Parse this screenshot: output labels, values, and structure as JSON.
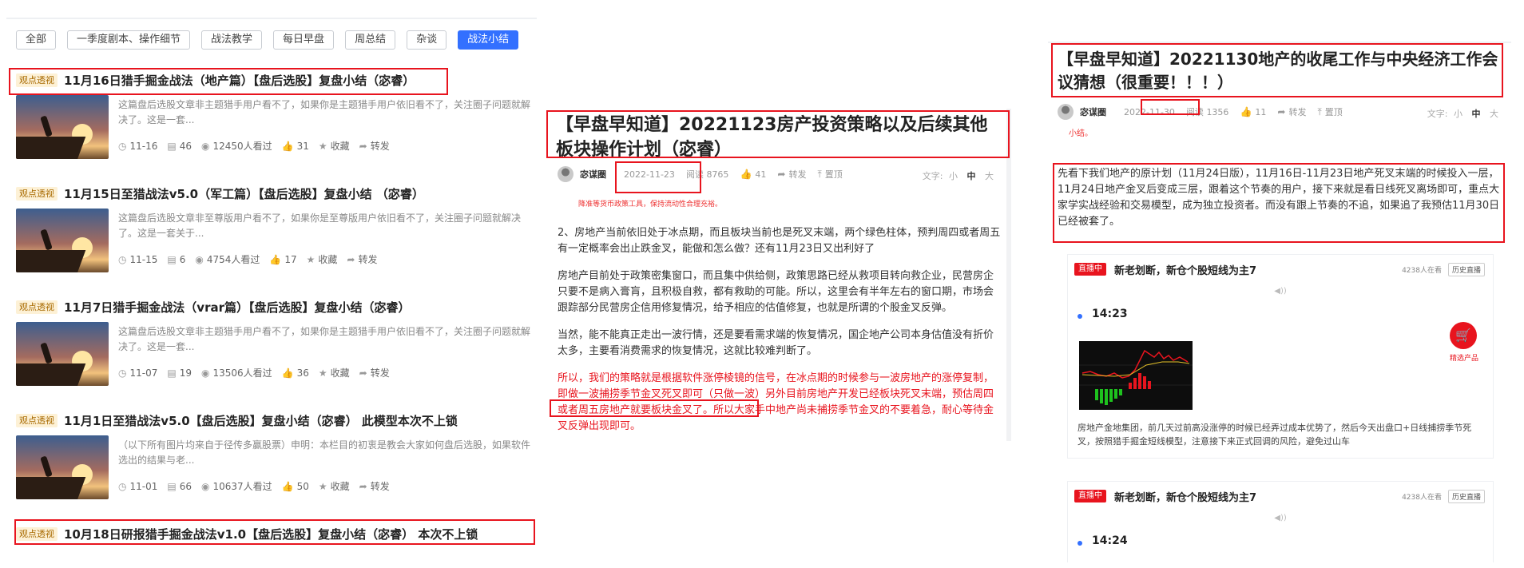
{
  "panel1": {
    "tabs": [
      "全部",
      "一季度剧本、操作细节",
      "战法教学",
      "每日早盘",
      "周总结",
      "杂谈",
      "战法小结"
    ],
    "active_tab": "战法小结",
    "articles": [
      {
        "badge": "观点透视",
        "title": "11月16日猎手掘金战法（地产篇）【盘后选股】复盘小结（宓睿）",
        "desc": "这篇盘后选股文章非主题猎手用户看不了，如果你是主题猎手用户依旧看不了，关注圈子问题就解决了。这是一套...",
        "date": "11-16",
        "comments": "46",
        "views": "12450人看过",
        "likes": "31",
        "fav": "收藏",
        "share": "转发"
      },
      {
        "badge": "观点透视",
        "title": "11月15日至猎战法v5.0（军工篇）【盘后选股】复盘小结 （宓睿）",
        "desc": "这篇盘后选股文章非至尊版用户看不了，如果你是至尊版用户依旧看不了，关注圈子问题就解决了。这是一套关于...",
        "date": "11-15",
        "comments": "6",
        "views": "4754人看过",
        "likes": "17",
        "fav": "收藏",
        "share": "转发"
      },
      {
        "badge": "观点透视",
        "title": "11月7日猎手掘金战法（vrar篇）【盘后选股】复盘小结（宓睿）",
        "desc": "这篇盘后选股文章非主题猎手用户看不了，如果你是主题猎手用户依旧看不了，关注圈子问题就解决了。这是一套...",
        "date": "11-07",
        "comments": "19",
        "views": "13506人看过",
        "likes": "36",
        "fav": "收藏",
        "share": "转发"
      },
      {
        "badge": "观点透视",
        "title": "11月1日至猎战法v5.0【盘后选股】复盘小结（宓睿） 此模型本次不上锁",
        "desc": "（以下所有图片均来自于径传多赢股票）申明：本栏目的初衷是教会大家如何盘后选股，如果软件选出的结果与老...",
        "date": "11-01",
        "comments": "66",
        "views": "10637人看过",
        "likes": "50",
        "fav": "收藏",
        "share": "转发"
      },
      {
        "badge": "观点透视",
        "title": "10月18日研报猎手掘金战法v1.0【盘后选股】复盘小结（宓睿） 本次不上锁"
      }
    ]
  },
  "panel2": {
    "title": "【早盘早知道】20221123房产投资策略以及后续其他板块操作计划（宓睿）",
    "author": "宓谋圈",
    "date": "2022-11-23",
    "read_label": "阅读",
    "read_count": "8765",
    "likes": "41",
    "share": "转发",
    "pin": "置顶",
    "font_label": "文字:",
    "font_options": [
      "小",
      "中",
      "大"
    ],
    "tip": "降准等货币政策工具，保持流动性合理充裕。",
    "paragraphs": [
      "2、房地产当前依旧处于冰点期，而且板块当前也是死叉末端，两个绿色柱体，预判周四或者周五有一定概率会出止跌金叉，能做和怎么做？还有11月23日又出利好了",
      "房地产目前处于政策密集窗口，而且集中供给侧，政策思路已经从救项目转向救企业，民营房企只要不是病入膏肓，且积极自救，都有救助的可能。所以，这里会有半年左右的窗口期，市场会跟踪部分民营房企信用修复情况，给予相应的估值修复，也就是所谓的个股金叉反弹。",
      "当然，能不能真正走出一波行情，还是要看需求端的恢复情况，国企地产公司本身估值没有折价太多，主要看消费需求的恢复情况，这就比较难判断了。"
    ],
    "red_paragraph": "所以，我们的策略就是根据软件涨停棱镜的信号，在冰点期的时候参与一波房地产的涨停复制，即做一波捕捞季节金叉死叉即可（只做一波）另外目前房地产开发已经板块死叉末端，预估周四或者周五房地产就要板块金叉了。所以大家手中地产尚未捕捞季节金叉的不要着急，耐心等待金叉反弹出现即可。"
  },
  "panel3": {
    "title": "【早盘早知道】20221130地产的收尾工作与中央经济工作会议猜想（很重要！！！）",
    "author": "宓谋圈",
    "date": "2022-11-30",
    "read_label": "阅读",
    "read_count": "1356",
    "likes": "11",
    "share": "转发",
    "pin": "置顶",
    "font_label": "文字:",
    "font_options": [
      "小",
      "中",
      "大"
    ],
    "cut_text": "小结。",
    "paragraph": "先看下我们地产的原计划（11月24日版），11月16日-11月23日地产死叉末端的时候投入一层，11月24日地产金叉后变成三层，跟着这个节奏的用户，接下来就是看日线死叉离场即可，重点大家学实战经验和交易模型，成为独立投资者。而没有跟上节奏的不追，如果追了我预估11月30日已经被套了。",
    "live_cards": [
      {
        "badge": "直播中",
        "title": "新老划断，新仓个股短线为主7",
        "viewers": "4238人在看",
        "history": "历史直播",
        "time": "14:23",
        "cart_label": "精选产品",
        "text": "房地产金地集团，前几天过前高没涨停的时候已经弄过成本优势了，然后今天出盘口+日线捕捞季节死叉，按照猎手掘金短线模型，注意接下来正式回调的风险，避免过山车"
      },
      {
        "badge": "直播中",
        "title": "新老划断，新仓个股短线为主7",
        "viewers": "4238人在看",
        "history": "历史直播",
        "time": "14:24"
      }
    ]
  },
  "colors": {
    "highlight_box": "#e8141e",
    "active_tab": "#3370ff",
    "badge_bg": "#fdf1d6",
    "badge_text": "#a86a00"
  }
}
